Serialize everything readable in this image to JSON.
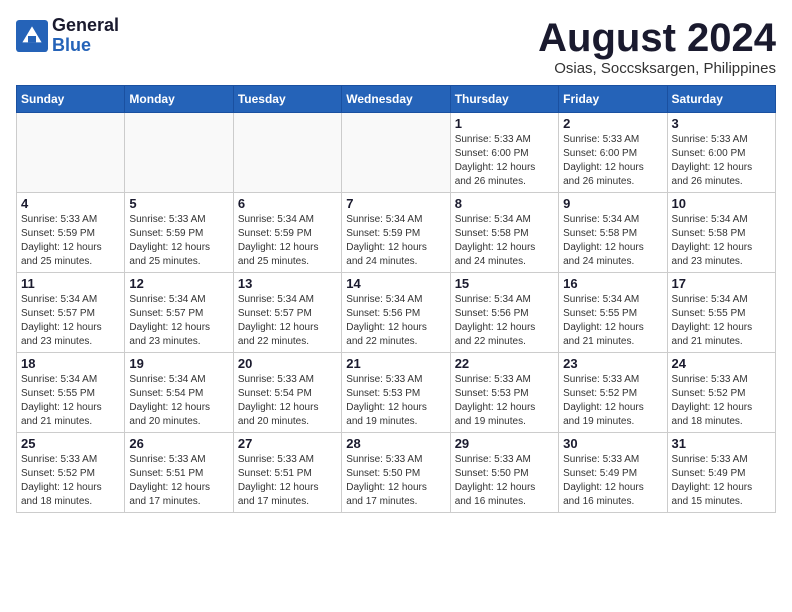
{
  "header": {
    "logo_line1": "General",
    "logo_line2": "Blue",
    "month_year": "August 2024",
    "location": "Osias, Soccsksargen, Philippines"
  },
  "weekdays": [
    "Sunday",
    "Monday",
    "Tuesday",
    "Wednesday",
    "Thursday",
    "Friday",
    "Saturday"
  ],
  "weeks": [
    [
      {
        "day": "",
        "info": ""
      },
      {
        "day": "",
        "info": ""
      },
      {
        "day": "",
        "info": ""
      },
      {
        "day": "",
        "info": ""
      },
      {
        "day": "1",
        "info": "Sunrise: 5:33 AM\nSunset: 6:00 PM\nDaylight: 12 hours\nand 26 minutes."
      },
      {
        "day": "2",
        "info": "Sunrise: 5:33 AM\nSunset: 6:00 PM\nDaylight: 12 hours\nand 26 minutes."
      },
      {
        "day": "3",
        "info": "Sunrise: 5:33 AM\nSunset: 6:00 PM\nDaylight: 12 hours\nand 26 minutes."
      }
    ],
    [
      {
        "day": "4",
        "info": "Sunrise: 5:33 AM\nSunset: 5:59 PM\nDaylight: 12 hours\nand 25 minutes."
      },
      {
        "day": "5",
        "info": "Sunrise: 5:33 AM\nSunset: 5:59 PM\nDaylight: 12 hours\nand 25 minutes."
      },
      {
        "day": "6",
        "info": "Sunrise: 5:34 AM\nSunset: 5:59 PM\nDaylight: 12 hours\nand 25 minutes."
      },
      {
        "day": "7",
        "info": "Sunrise: 5:34 AM\nSunset: 5:59 PM\nDaylight: 12 hours\nand 24 minutes."
      },
      {
        "day": "8",
        "info": "Sunrise: 5:34 AM\nSunset: 5:58 PM\nDaylight: 12 hours\nand 24 minutes."
      },
      {
        "day": "9",
        "info": "Sunrise: 5:34 AM\nSunset: 5:58 PM\nDaylight: 12 hours\nand 24 minutes."
      },
      {
        "day": "10",
        "info": "Sunrise: 5:34 AM\nSunset: 5:58 PM\nDaylight: 12 hours\nand 23 minutes."
      }
    ],
    [
      {
        "day": "11",
        "info": "Sunrise: 5:34 AM\nSunset: 5:57 PM\nDaylight: 12 hours\nand 23 minutes."
      },
      {
        "day": "12",
        "info": "Sunrise: 5:34 AM\nSunset: 5:57 PM\nDaylight: 12 hours\nand 23 minutes."
      },
      {
        "day": "13",
        "info": "Sunrise: 5:34 AM\nSunset: 5:57 PM\nDaylight: 12 hours\nand 22 minutes."
      },
      {
        "day": "14",
        "info": "Sunrise: 5:34 AM\nSunset: 5:56 PM\nDaylight: 12 hours\nand 22 minutes."
      },
      {
        "day": "15",
        "info": "Sunrise: 5:34 AM\nSunset: 5:56 PM\nDaylight: 12 hours\nand 22 minutes."
      },
      {
        "day": "16",
        "info": "Sunrise: 5:34 AM\nSunset: 5:55 PM\nDaylight: 12 hours\nand 21 minutes."
      },
      {
        "day": "17",
        "info": "Sunrise: 5:34 AM\nSunset: 5:55 PM\nDaylight: 12 hours\nand 21 minutes."
      }
    ],
    [
      {
        "day": "18",
        "info": "Sunrise: 5:34 AM\nSunset: 5:55 PM\nDaylight: 12 hours\nand 21 minutes."
      },
      {
        "day": "19",
        "info": "Sunrise: 5:34 AM\nSunset: 5:54 PM\nDaylight: 12 hours\nand 20 minutes."
      },
      {
        "day": "20",
        "info": "Sunrise: 5:33 AM\nSunset: 5:54 PM\nDaylight: 12 hours\nand 20 minutes."
      },
      {
        "day": "21",
        "info": "Sunrise: 5:33 AM\nSunset: 5:53 PM\nDaylight: 12 hours\nand 19 minutes."
      },
      {
        "day": "22",
        "info": "Sunrise: 5:33 AM\nSunset: 5:53 PM\nDaylight: 12 hours\nand 19 minutes."
      },
      {
        "day": "23",
        "info": "Sunrise: 5:33 AM\nSunset: 5:52 PM\nDaylight: 12 hours\nand 19 minutes."
      },
      {
        "day": "24",
        "info": "Sunrise: 5:33 AM\nSunset: 5:52 PM\nDaylight: 12 hours\nand 18 minutes."
      }
    ],
    [
      {
        "day": "25",
        "info": "Sunrise: 5:33 AM\nSunset: 5:52 PM\nDaylight: 12 hours\nand 18 minutes."
      },
      {
        "day": "26",
        "info": "Sunrise: 5:33 AM\nSunset: 5:51 PM\nDaylight: 12 hours\nand 17 minutes."
      },
      {
        "day": "27",
        "info": "Sunrise: 5:33 AM\nSunset: 5:51 PM\nDaylight: 12 hours\nand 17 minutes."
      },
      {
        "day": "28",
        "info": "Sunrise: 5:33 AM\nSunset: 5:50 PM\nDaylight: 12 hours\nand 17 minutes."
      },
      {
        "day": "29",
        "info": "Sunrise: 5:33 AM\nSunset: 5:50 PM\nDaylight: 12 hours\nand 16 minutes."
      },
      {
        "day": "30",
        "info": "Sunrise: 5:33 AM\nSunset: 5:49 PM\nDaylight: 12 hours\nand 16 minutes."
      },
      {
        "day": "31",
        "info": "Sunrise: 5:33 AM\nSunset: 5:49 PM\nDaylight: 12 hours\nand 15 minutes."
      }
    ]
  ]
}
